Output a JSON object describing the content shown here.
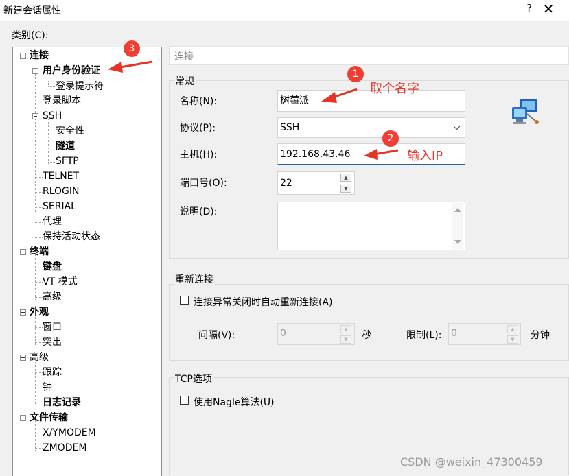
{
  "window": {
    "title": "新建会话属性",
    "help_label": "?",
    "close_label": "✕"
  },
  "category_label": "类别(C):",
  "tree": {
    "items": [
      {
        "label": "连接"
      },
      {
        "label": "用户身份验证"
      },
      {
        "label": "登录提示符"
      },
      {
        "label": "登录脚本"
      },
      {
        "label": "SSH"
      },
      {
        "label": "安全性"
      },
      {
        "label": "隧道"
      },
      {
        "label": "SFTP"
      },
      {
        "label": "TELNET"
      },
      {
        "label": "RLOGIN"
      },
      {
        "label": "SERIAL"
      },
      {
        "label": "代理"
      },
      {
        "label": "保持活动状态"
      },
      {
        "label": "终端"
      },
      {
        "label": "键盘"
      },
      {
        "label": "VT 模式"
      },
      {
        "label": "高级"
      },
      {
        "label": "外观"
      },
      {
        "label": "窗口"
      },
      {
        "label": "突出"
      },
      {
        "label": "高级"
      },
      {
        "label": "跟踪"
      },
      {
        "label": "钟"
      },
      {
        "label": "日志记录"
      },
      {
        "label": "文件传输"
      },
      {
        "label": "X/YMODEM"
      },
      {
        "label": "ZMODEM"
      }
    ]
  },
  "header": {
    "text": "连接"
  },
  "general": {
    "title": "常规",
    "name_label": "名称(N):",
    "name_value": "树莓派",
    "protocol_label": "协议(P):",
    "protocol_value": "SSH",
    "host_label": "主机(H):",
    "host_value": "192.168.43.46",
    "port_label": "端口号(O):",
    "port_value": "22",
    "desc_label": "说明(D):",
    "desc_value": ""
  },
  "reconnect": {
    "title": "重新连接",
    "checkbox_label": "连接异常关闭时自动重新连接(A)",
    "interval_label": "间隔(V):",
    "interval_value": "0",
    "interval_unit": "秒",
    "limit_label": "限制(L):",
    "limit_value": "0",
    "limit_unit": "分钟"
  },
  "tcp": {
    "title": "TCP选项",
    "nagle_label": "使用Nagle算法(U)"
  },
  "annotations": {
    "badge1": "1",
    "text1": "取个名字",
    "badge2": "2",
    "text2": "输入IP",
    "badge3": "3"
  },
  "watermark": "CSDN @weixin_47300459",
  "colors": {
    "annotation_red": "#e53326",
    "focus_blue": "#2b5fa0"
  }
}
